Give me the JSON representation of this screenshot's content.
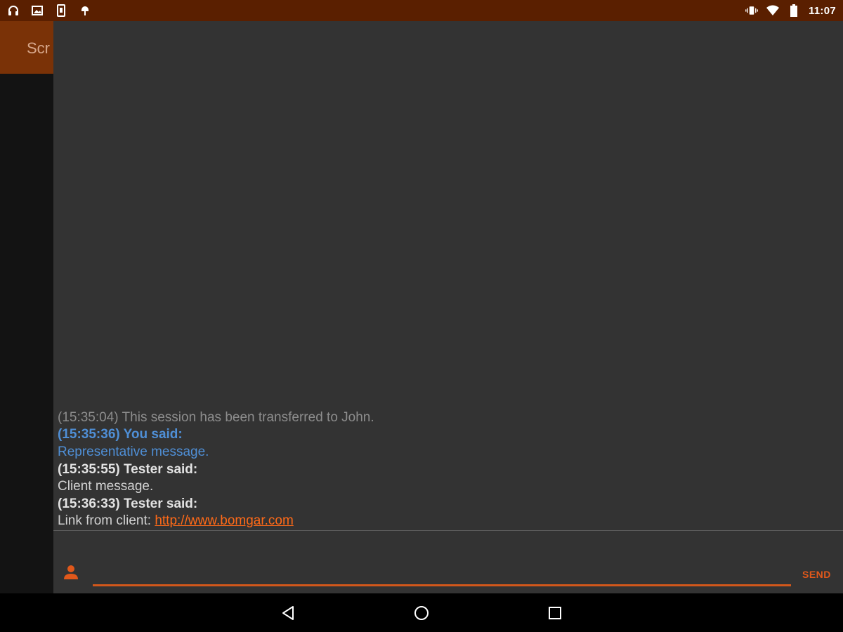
{
  "status_bar": {
    "time": "11:07",
    "left_icons": [
      "headphones-icon",
      "image-icon",
      "phone-icon",
      "android-debug-icon"
    ],
    "right_icons": [
      "vibrate-icon",
      "wifi-icon",
      "battery-icon"
    ]
  },
  "background_app": {
    "toolbar_title": "Scr"
  },
  "chat": {
    "messages": [
      {
        "type": "system",
        "text": "(15:35:04) This session has been transferred to John."
      },
      {
        "type": "rep-header",
        "text": "(15:35:36) You said:"
      },
      {
        "type": "rep-body",
        "text": "Representative message."
      },
      {
        "type": "client-header",
        "text": "(15:35:55) Tester said:"
      },
      {
        "type": "client-body",
        "text": "Client message."
      },
      {
        "type": "client-header",
        "text": "(15:36:33) Tester said:"
      },
      {
        "type": "client-body",
        "prefix": "Link from client: ",
        "link": "http://www.bomgar.com"
      }
    ],
    "input": {
      "value": "",
      "placeholder": ""
    },
    "send_label": "SEND"
  },
  "colors": {
    "status_bar": "#5a1f00",
    "toolbar": "#7a3207",
    "panel": "#333333",
    "accent": "#e0581b",
    "rep_text": "#4f8fd6",
    "system_text": "#8d8d8d"
  }
}
